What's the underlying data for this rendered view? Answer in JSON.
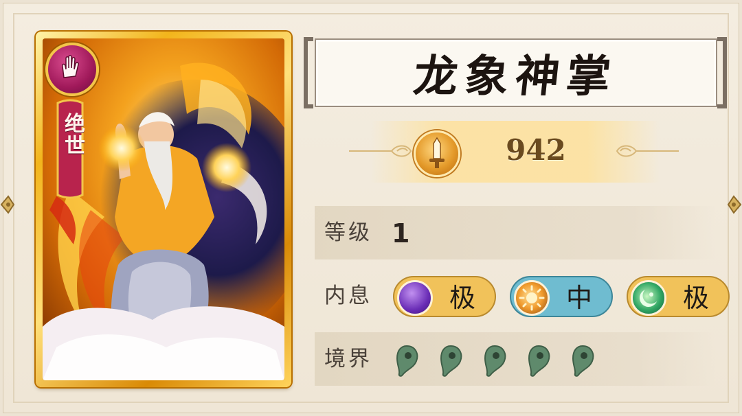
{
  "skill": {
    "name": "龙象神掌",
    "rarity": "绝世",
    "power": "942"
  },
  "stats": {
    "level_label": "等级",
    "level_value": "1",
    "neixi_label": "内息",
    "neixi": [
      {
        "orb": "purple-moon-orb-icon",
        "grade": "极"
      },
      {
        "orb": "orange-sun-orb-icon",
        "grade": "中"
      },
      {
        "orb": "green-crescent-orb-icon",
        "grade": "极"
      }
    ],
    "realm_label": "境界",
    "realm_pips": 5
  },
  "colors": {
    "card_gold": "#f2b51c",
    "rarity_magenta": "#a0195a",
    "pill_gold": "#f1c25a",
    "pill_blue": "#6fbcd0",
    "realm_jade": "#5f8a6c"
  }
}
